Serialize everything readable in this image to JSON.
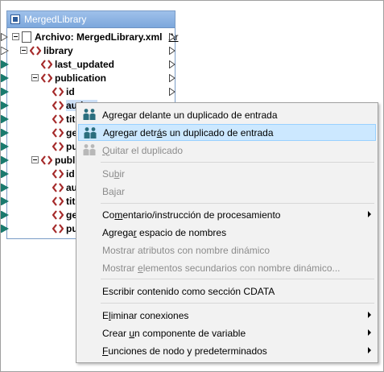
{
  "component": {
    "title": "MergedLibrary",
    "file_label": "Archivo: MergedLibrary.xml",
    "file_suffix": "Ar",
    "nodes": [
      {
        "label": "library"
      },
      {
        "label": "last_updated"
      },
      {
        "label": "publication"
      },
      {
        "label": "id"
      },
      {
        "label": "auth"
      },
      {
        "label": "title"
      },
      {
        "label": "genr"
      },
      {
        "label": "publ"
      },
      {
        "label": "publica"
      },
      {
        "label": "id"
      },
      {
        "label": "auth"
      },
      {
        "label": "title"
      },
      {
        "label": "genr"
      },
      {
        "label": "publ"
      }
    ]
  },
  "context_menu": {
    "items": [
      {
        "pre": "A",
        "u": "g",
        "post": "regar delante un duplicado de entrada",
        "icon": "duplicate-before-icon",
        "disabled": false,
        "highlighted": false,
        "submenu": false
      },
      {
        "pre": "Agregar detr",
        "u": "á",
        "post": "s un duplicado de entrada",
        "icon": "duplicate-after-icon",
        "disabled": false,
        "highlighted": true,
        "submenu": false
      },
      {
        "pre": "",
        "u": "Q",
        "post": "uitar el duplicado",
        "icon": "remove-duplicate-icon",
        "disabled": true,
        "highlighted": false,
        "submenu": false
      },
      {
        "pre": "Su",
        "u": "b",
        "post": "ir",
        "disabled": true,
        "highlighted": false,
        "submenu": false
      },
      {
        "pre": "Bajar",
        "u": "",
        "post": "",
        "disabled": true,
        "highlighted": false,
        "submenu": false
      },
      {
        "pre": "Co",
        "u": "m",
        "post": "entario/instrucción de procesamiento",
        "disabled": false,
        "highlighted": false,
        "submenu": true
      },
      {
        "pre": "Agrega",
        "u": "r",
        "post": " espacio de nombres",
        "disabled": false,
        "highlighted": false,
        "submenu": false
      },
      {
        "pre": "Mostrar atributos con nombre dinámico",
        "u": "",
        "post": "",
        "disabled": true,
        "highlighted": false,
        "submenu": false
      },
      {
        "pre": "Mostrar ",
        "u": "e",
        "post": "lementos secundarios con nombre dinámico...",
        "disabled": true,
        "highlighted": false,
        "submenu": false
      },
      {
        "pre": "Escribir contenido como sección CDATA",
        "u": "",
        "post": "",
        "disabled": false,
        "highlighted": false,
        "submenu": false
      },
      {
        "pre": "E",
        "u": "l",
        "post": "iminar conexiones",
        "disabled": false,
        "highlighted": false,
        "submenu": true
      },
      {
        "pre": "Crear ",
        "u": "u",
        "post": "n componente de variable",
        "disabled": false,
        "highlighted": false,
        "submenu": true
      },
      {
        "pre": "",
        "u": "F",
        "post": "unciones de nodo y predeterminados",
        "disabled": false,
        "highlighted": false,
        "submenu": true
      }
    ]
  },
  "colors": {
    "element_icon": "#a52a2a",
    "connector": "#1a7a6e",
    "title_bar": "#8fb5e4",
    "highlight": "#cce8ff"
  }
}
